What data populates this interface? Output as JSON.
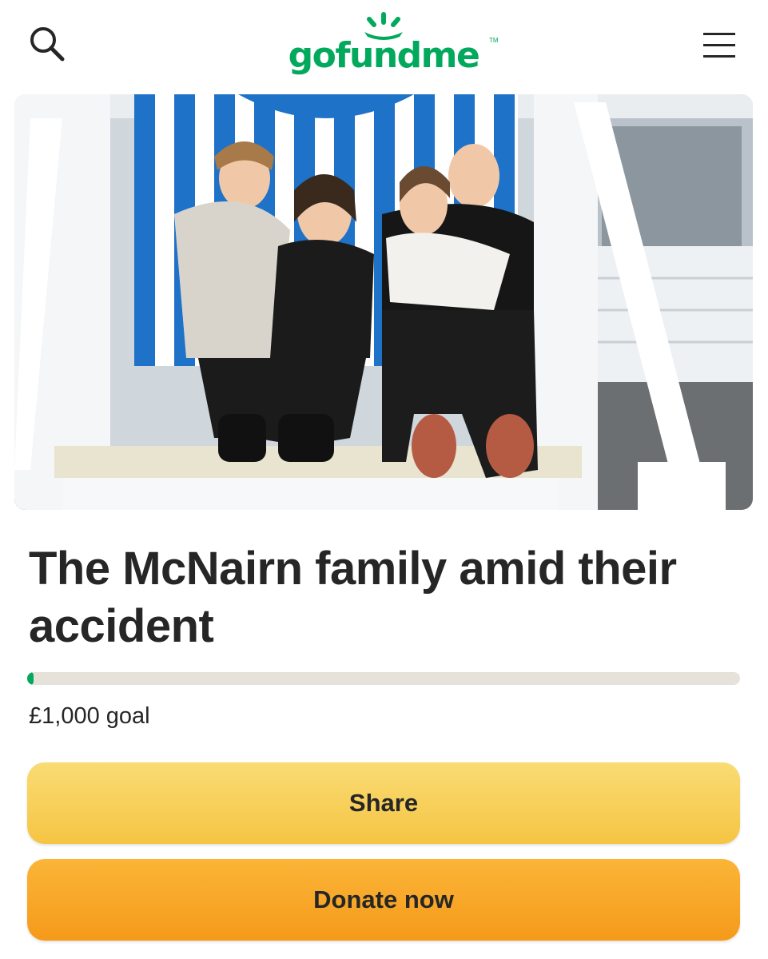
{
  "header": {
    "logo_text": "gofundme",
    "logo_tm": "TM",
    "brand_color": "#02a95c",
    "search_icon": "search-icon",
    "menu_icon": "hamburger-menu-icon"
  },
  "hero": {
    "image_subject": "photo",
    "icon": "photo-image"
  },
  "campaign": {
    "title": "The McNairn family amid their accident",
    "progress_fraction": 0.005,
    "goal_text": "£1,000 goal"
  },
  "actions": {
    "share_label": "Share",
    "donate_label": "Donate now",
    "share_color": "#f6c443",
    "donate_color": "#f59a1b"
  }
}
